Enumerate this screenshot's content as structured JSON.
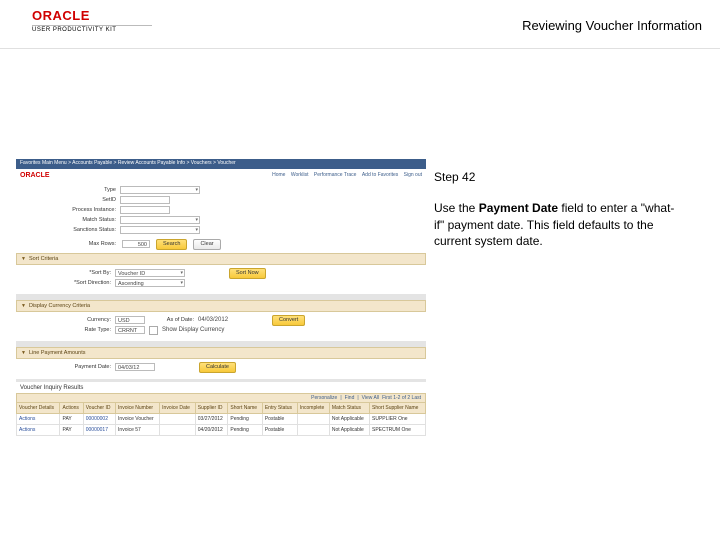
{
  "header": {
    "brand": "ORACLE",
    "subbrand": "USER PRODUCTIVITY KIT",
    "topic_title": "Reviewing Voucher Information"
  },
  "right": {
    "step_label": "Step 42",
    "instruction_pre": "Use the ",
    "instruction_bold": "Payment Date",
    "instruction_post": " field to enter a \"what-if\" payment date. This field defaults to the current system date."
  },
  "app": {
    "brand": "ORACLE",
    "breadcrumb": "Favorites   Main Menu > Accounts Payable > Review Accounts Payable Info > Vouchers > Voucher",
    "top_links": [
      "Home",
      "Worklist",
      "Performance Trace",
      "Add to Favorites",
      "Sign out"
    ],
    "form": {
      "search_label": "Search",
      "type_label": "Type",
      "setid_label": "SetID",
      "process_instance_label": "Process Instance:",
      "match_status_label": "Match Status:",
      "sanctions_status_label": "Sanctions Status:",
      "max_rows_label": "Max Rows:",
      "max_rows_value": "500",
      "search_btn": "Search",
      "clear_btn": "Clear"
    },
    "sections": {
      "sort_criteria": {
        "title": "Sort Criteria",
        "sort_by_label": "*Sort By:",
        "sort_by_value": "Voucher ID",
        "sort_order_label": "*Sort Direction:",
        "sort_order_value": "Ascending",
        "sort_now_btn": "Sort Now"
      },
      "display_currency": {
        "title": "Display Currency Criteria",
        "currency_label": "Currency:",
        "currency_value": "USD",
        "as_of_date_label": "As of Date:",
        "as_of_date_value": "04/03/2012",
        "rate_type_label": "Rate Type:",
        "rate_type_value": "CRRNT",
        "show_display_label": "Show Display Currency",
        "convert_btn": "Convert"
      },
      "line_payment": {
        "title": "Line Payment Amounts",
        "payment_date_label": "Payment Date:",
        "payment_date_value": "04/03/12",
        "calculate_btn": "Calculate"
      }
    },
    "results": {
      "title": "Voucher Inquiry Results",
      "pager": {
        "personalize": "Personalize",
        "find": "Find",
        "viewall": "View All",
        "range": "First 1-2 of 2 Last"
      },
      "columns": [
        "Voucher Details",
        "Actions",
        "Voucher ID",
        "Invoice Number",
        "Invoice Date",
        "Supplier ID",
        "Short Name",
        "Entry Status",
        "Incomplete",
        "Match Status",
        "Short Supplier Name"
      ],
      "rows": [
        {
          "actions": "Actions",
          "voucher_id": "PAY",
          "inv_no": "00000002",
          "inv_num2": "Invoice Voucher",
          "inv_date": "",
          "supplier": "03/27/2012",
          "short": "Pending",
          "entry": "Postable",
          "match": "Not Applicable",
          "sup": "SUPPLIER One"
        },
        {
          "actions": "Actions",
          "voucher_id": "PAY",
          "inv_no": "00000017",
          "inv_num2": "Invoice 57",
          "inv_date": "",
          "supplier": "04/20/2012",
          "short": "Pending",
          "entry": "Postable",
          "match": "Not Applicable",
          "sup": "SPECTRUM One"
        }
      ]
    }
  }
}
